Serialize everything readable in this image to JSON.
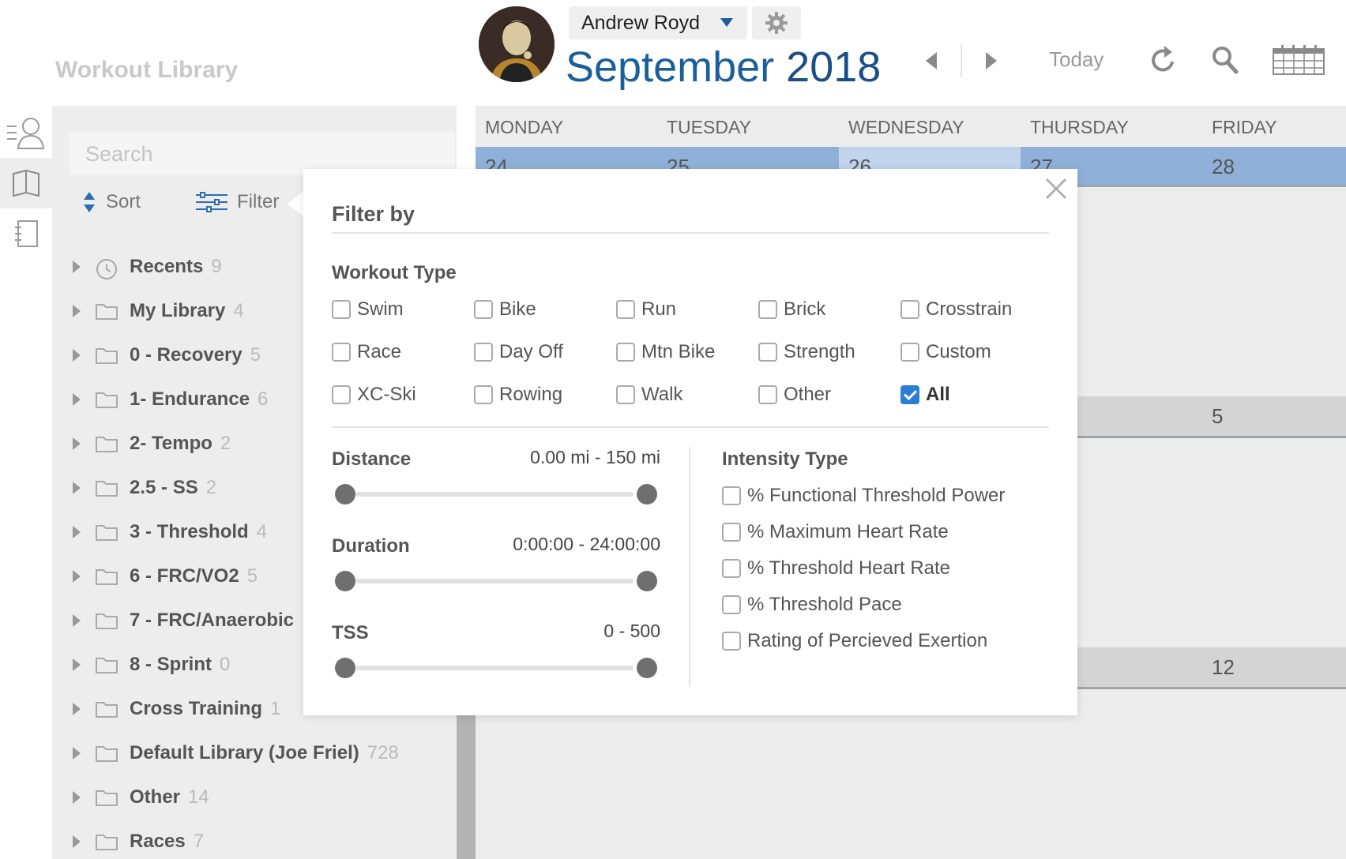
{
  "header": {
    "library_title": "Workout Library",
    "user_name": "Andrew Royd",
    "month": "September",
    "year": "2018",
    "today_label": "Today"
  },
  "library": {
    "search_placeholder": "Search",
    "sort_label": "Sort",
    "filter_label": "Filter",
    "items": [
      {
        "label": "Recents",
        "count": "9",
        "icon": "clock-icon"
      },
      {
        "label": "My Library",
        "count": "4",
        "icon": "folder-icon"
      },
      {
        "label": "0 - Recovery",
        "count": "5",
        "icon": "folder-icon"
      },
      {
        "label": "1- Endurance",
        "count": "6",
        "icon": "folder-icon"
      },
      {
        "label": "2- Tempo",
        "count": "2",
        "icon": "folder-icon"
      },
      {
        "label": "2.5 - SS",
        "count": "2",
        "icon": "folder-icon"
      },
      {
        "label": "3 - Threshold",
        "count": "4",
        "icon": "folder-icon"
      },
      {
        "label": "6 - FRC/VO2",
        "count": "5",
        "icon": "folder-icon"
      },
      {
        "label": "7 - FRC/Anaerobic",
        "count": "",
        "icon": "folder-icon"
      },
      {
        "label": "8 - Sprint",
        "count": "0",
        "icon": "folder-icon"
      },
      {
        "label": "Cross Training",
        "count": "1",
        "icon": "folder-icon"
      },
      {
        "label": "Default Library (Joe Friel)",
        "count": "728",
        "icon": "folder-icon"
      },
      {
        "label": "Other",
        "count": "14",
        "icon": "folder-icon"
      },
      {
        "label": "Races",
        "count": "7",
        "icon": "folder-icon"
      }
    ]
  },
  "calendar": {
    "day_names": [
      "MONDAY",
      "TUESDAY",
      "WEDNESDAY",
      "THURSDAY",
      "FRIDAY"
    ],
    "week1": [
      "24",
      "25",
      "26",
      "27",
      "28"
    ],
    "week2_friday": "5",
    "week3_friday": "12",
    "colors": {
      "week_bg": "#8fb0d8",
      "today_bg": "#c0d4ec",
      "other_week_bg": "#d4d4d4"
    }
  },
  "filter": {
    "title": "Filter by",
    "workout_type_heading": "Workout Type",
    "workout_types": [
      {
        "label": "Swim",
        "checked": false
      },
      {
        "label": "Bike",
        "checked": false
      },
      {
        "label": "Run",
        "checked": false
      },
      {
        "label": "Brick",
        "checked": false
      },
      {
        "label": "Crosstrain",
        "checked": false
      },
      {
        "label": "Race",
        "checked": false
      },
      {
        "label": "Day Off",
        "checked": false
      },
      {
        "label": "Mtn Bike",
        "checked": false
      },
      {
        "label": "Strength",
        "checked": false
      },
      {
        "label": "Custom",
        "checked": false
      },
      {
        "label": "XC-Ski",
        "checked": false
      },
      {
        "label": "Rowing",
        "checked": false
      },
      {
        "label": "Walk",
        "checked": false
      },
      {
        "label": "Other",
        "checked": false
      },
      {
        "label": "All",
        "checked": true
      }
    ],
    "ranges": [
      {
        "label": "Distance",
        "value": "0.00 mi - 150 mi"
      },
      {
        "label": "Duration",
        "value": "0:00:00 - 24:00:00"
      },
      {
        "label": "TSS",
        "value": "0 - 500"
      }
    ],
    "intensity_heading": "Intensity Type",
    "intensity_types": [
      {
        "label": "% Functional Threshold Power",
        "checked": false
      },
      {
        "label": "% Maximum Heart Rate",
        "checked": false
      },
      {
        "label": "% Threshold Heart Rate",
        "checked": false
      },
      {
        "label": "% Threshold Pace",
        "checked": false
      },
      {
        "label": "Rating of Percieved Exertion",
        "checked": false
      }
    ]
  }
}
